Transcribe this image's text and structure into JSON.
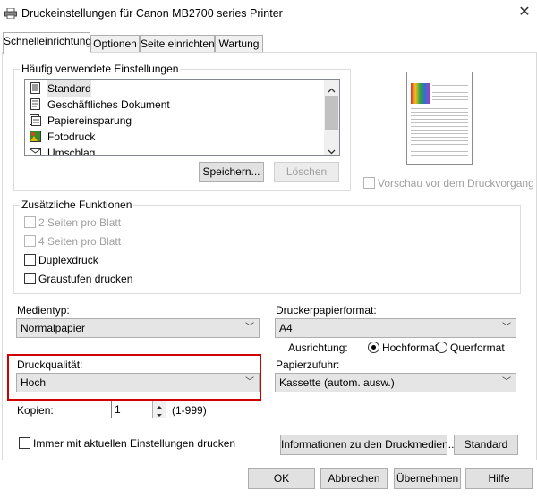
{
  "window": {
    "title": "Druckeinstellungen für Canon MB2700 series Printer"
  },
  "tabs": [
    {
      "label": "Schnelleinrichtung"
    },
    {
      "label": "Optionen"
    },
    {
      "label": "Seite einrichten"
    },
    {
      "label": "Wartung"
    }
  ],
  "common_settings": {
    "title": "Häufig verwendete Einstellungen",
    "items": [
      {
        "label": "Standard",
        "icon": "standard-page-icon",
        "selected": true
      },
      {
        "label": "Geschäftliches Dokument",
        "icon": "document-icon"
      },
      {
        "label": "Papiereinsparung",
        "icon": "paper-saving-icon"
      },
      {
        "label": "Fotodruck",
        "icon": "photo-icon"
      },
      {
        "label": "Umschlag",
        "icon": "envelope-icon"
      }
    ],
    "save_label": "Speichern...",
    "delete_label": "Löschen"
  },
  "preview": {
    "checkbox_label": "Vorschau vor dem Druckvorgang",
    "colors": [
      "#e03030",
      "#f0c020",
      "#30a040",
      "#3070d0",
      "#a040c0"
    ]
  },
  "additional": {
    "title": "Zusätzliche Funktionen",
    "options": [
      {
        "label": "2 Seiten pro Blatt",
        "enabled": false
      },
      {
        "label": "4 Seiten pro Blatt",
        "enabled": false
      },
      {
        "label": "Duplexdruck",
        "enabled": true
      },
      {
        "label": "Graustufen drucken",
        "enabled": true
      }
    ]
  },
  "media_type": {
    "label": "Medientyp:",
    "value": "Normalpapier"
  },
  "paper_size": {
    "label": "Druckerpapierformat:",
    "value": "A4"
  },
  "orientation": {
    "label": "Ausrichtung:",
    "portrait": "Hochformat",
    "landscape": "Querformat",
    "selected": "Hochformat"
  },
  "print_quality": {
    "label": "Druckqualität:",
    "value": "Hoch",
    "highlight_color": "#d00000"
  },
  "paper_source": {
    "label": "Papierzufuhr:",
    "value": "Kassette (autom. ausw.)"
  },
  "copies": {
    "label": "Kopien:",
    "value": "1",
    "range": "(1-999)"
  },
  "always_print_label": "Immer mit aktuellen Einstellungen drucken",
  "media_info_label": "Informationen zu den Druckmedien...",
  "standard_label": "Standard",
  "footer": {
    "ok": "OK",
    "cancel": "Abbrechen",
    "apply": "Übernehmen",
    "help": "Hilfe"
  }
}
